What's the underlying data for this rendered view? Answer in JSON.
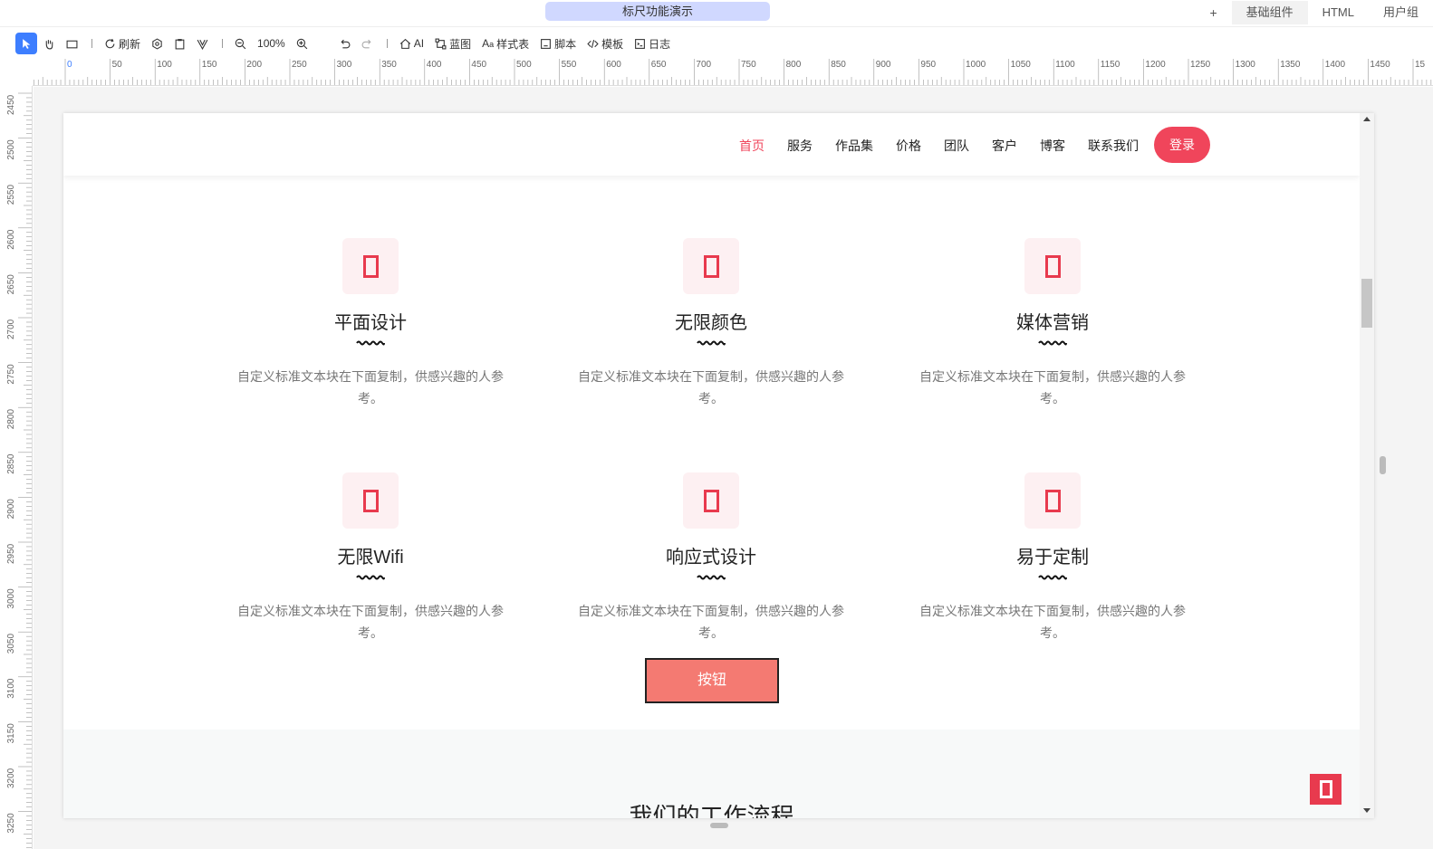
{
  "app": {
    "window_title": "标尺功能演示",
    "right_tabs": {
      "plus": "+",
      "basic_components": "基础组件",
      "html": "HTML",
      "user": "用户组"
    }
  },
  "toolbar": {
    "refresh": "刷新",
    "zoom": "100%",
    "ai": "AI",
    "blueprint": "蓝图",
    "stylesheet": "样式表",
    "script": "脚本",
    "template": "模板",
    "log": "日志"
  },
  "ruler": {
    "h_labels": [
      "0",
      "0",
      "50",
      "100",
      "150",
      "200",
      "250",
      "300",
      "350",
      "400",
      "450",
      "500",
      "550",
      "600",
      "650",
      "700",
      "750",
      "800",
      "850",
      "900",
      "950",
      "1000",
      "1050",
      "1100",
      "1150",
      "1200",
      "1250",
      "1300",
      "1350",
      "1400",
      "1450",
      "15"
    ],
    "v_labels": [
      "2450",
      "2500",
      "2550",
      "2600",
      "2650",
      "2700",
      "2750",
      "2800",
      "2850",
      "2900",
      "2950",
      "3000",
      "3050",
      "3100",
      "3150",
      "3200",
      "3250"
    ]
  },
  "nav": {
    "items": [
      "首页",
      "服务",
      "作品集",
      "价格",
      "团队",
      "客户",
      "博客",
      "联系我们"
    ],
    "login": "登录"
  },
  "features": [
    {
      "title": "平面设计",
      "desc": "自定义标准文本块在下面复制，供感兴趣的人参考。"
    },
    {
      "title": "无限颜色",
      "desc": "自定义标准文本块在下面复制，供感兴趣的人参考。"
    },
    {
      "title": "媒体营销",
      "desc": "自定义标准文本块在下面复制，供感兴趣的人参考。"
    },
    {
      "title": "无限Wifi",
      "desc": "自定义标准文本块在下面复制，供感兴趣的人参考。"
    },
    {
      "title": "响应式设计",
      "desc": "自定义标准文本块在下面复制，供感兴趣的人参考。"
    },
    {
      "title": "易于定制",
      "desc": "自定义标准文本块在下面复制，供感兴趣的人参考。"
    }
  ],
  "cta": {
    "label": "按钮"
  },
  "section2": {
    "title": "我们的工作流程"
  },
  "colors": {
    "accent": "#f0455b",
    "button": "#f47a72",
    "selected_tool": "#3d7eff"
  }
}
